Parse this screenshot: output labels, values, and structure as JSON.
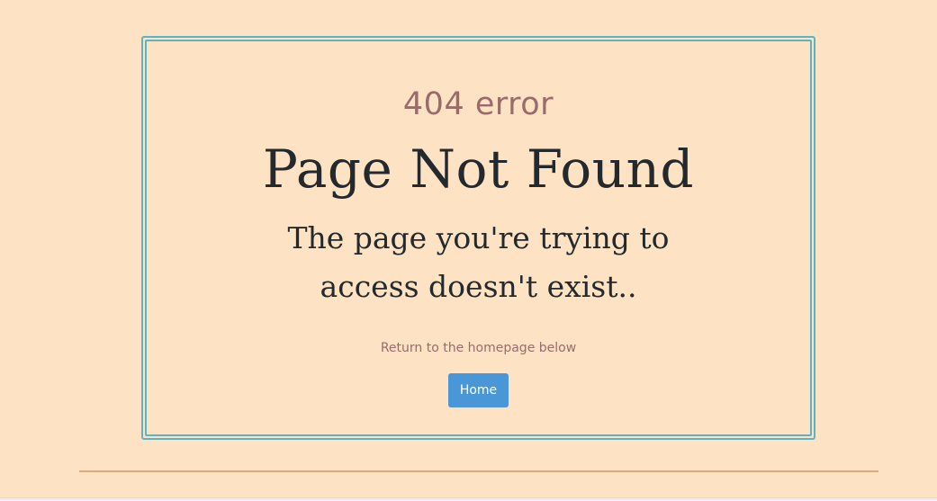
{
  "error": {
    "code_text": "404 error",
    "title": "Page Not Found",
    "message": "The page you're trying to access doesn't exist..",
    "hint": "Return to the homepage below",
    "home_button_label": "Home"
  },
  "colors": {
    "background": "#fde3c4",
    "frame_border": "#5bb3c4",
    "accent_text": "#9a6b6b",
    "title_text": "#24292d",
    "button": "#4a97d7",
    "divider": "#e1a878"
  }
}
